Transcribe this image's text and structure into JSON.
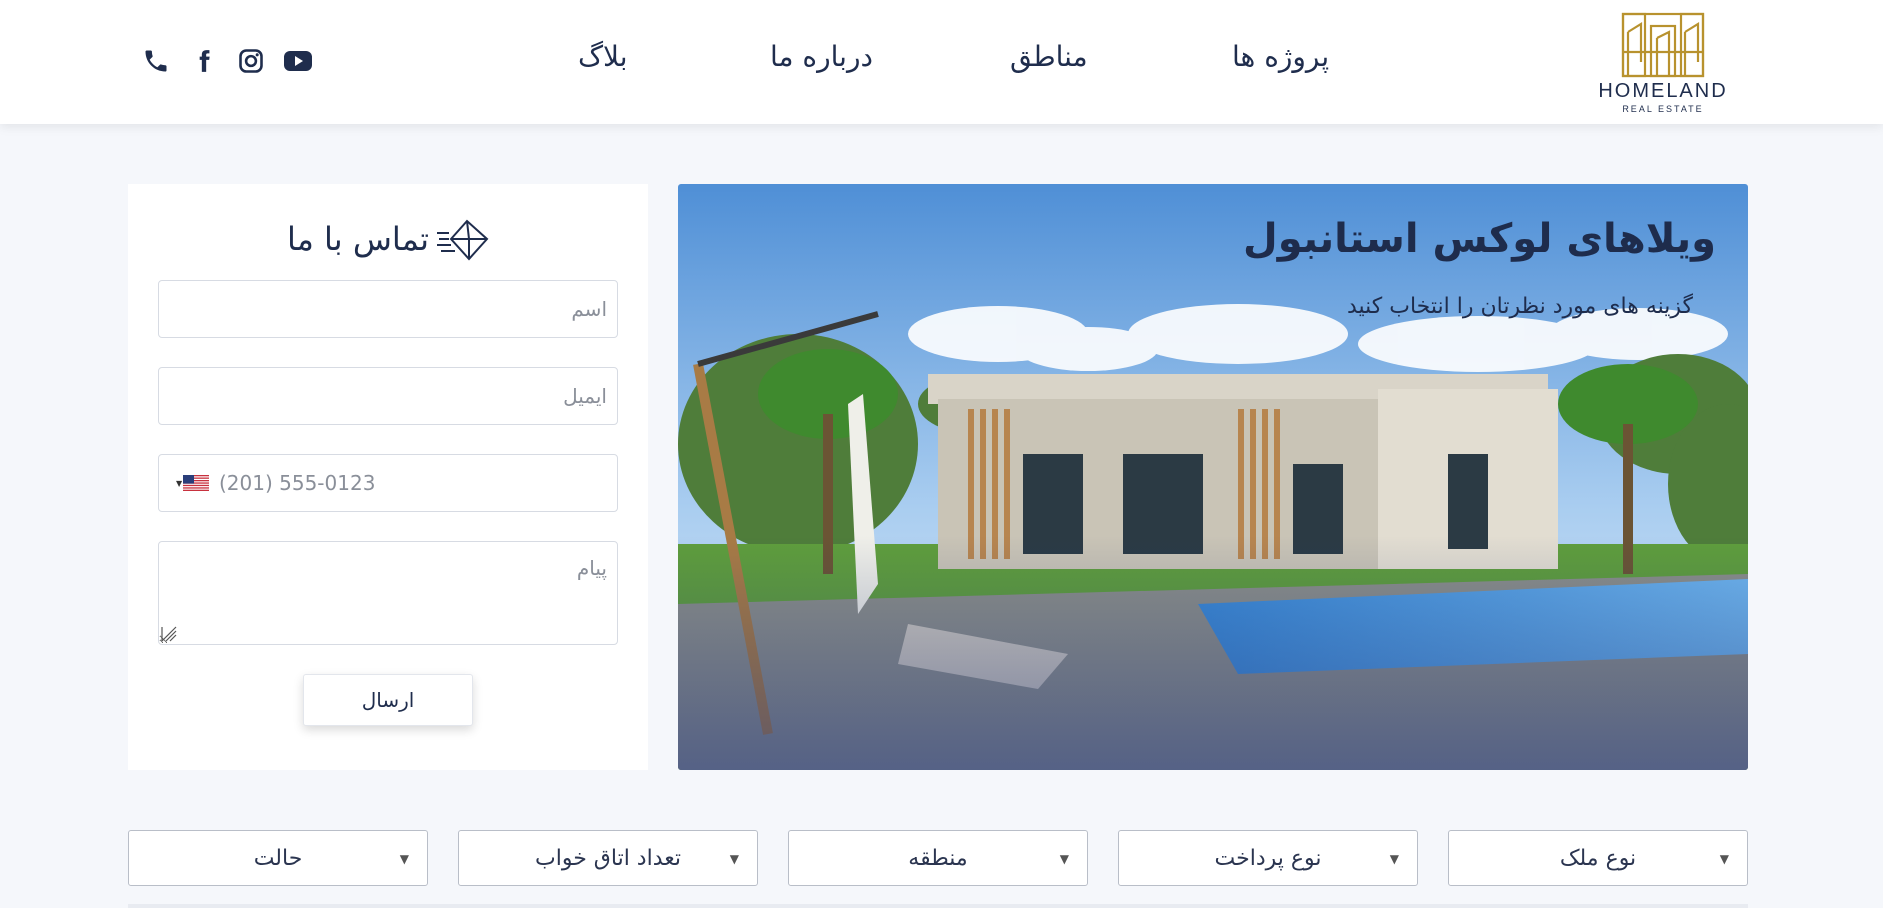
{
  "brand": {
    "name": "HOMELAND",
    "tagline": "REAL ESTATE",
    "color": "#b8922e"
  },
  "nav": {
    "projects": "پروژه ها",
    "areas": "مناطق",
    "about": "درباره ما",
    "blog": "بلاگ"
  },
  "social": [
    "phone-icon",
    "facebook-icon",
    "instagram-icon",
    "youtube-icon"
  ],
  "contact": {
    "title": "تماس با ما",
    "name_placeholder": "اسم",
    "email_placeholder": "ایمیل",
    "phone_placeholder": "(201) 555-0123",
    "message_placeholder": "پیام",
    "send_label": "ارسال"
  },
  "banner": {
    "title": "ویلاهای لوکس استانبول",
    "subtitle": "گزینه های مورد نظرتان را انتخاب کنید"
  },
  "filters": {
    "property_type": "نوع ملک",
    "payment_type": "نوع پرداخت",
    "region": "منطقه",
    "bedrooms": "تعداد اتاق خواب",
    "status": "حالت"
  },
  "colors": {
    "primary": "#1f2d4d",
    "background": "#f5f7fb",
    "accent": "#b8922e"
  }
}
